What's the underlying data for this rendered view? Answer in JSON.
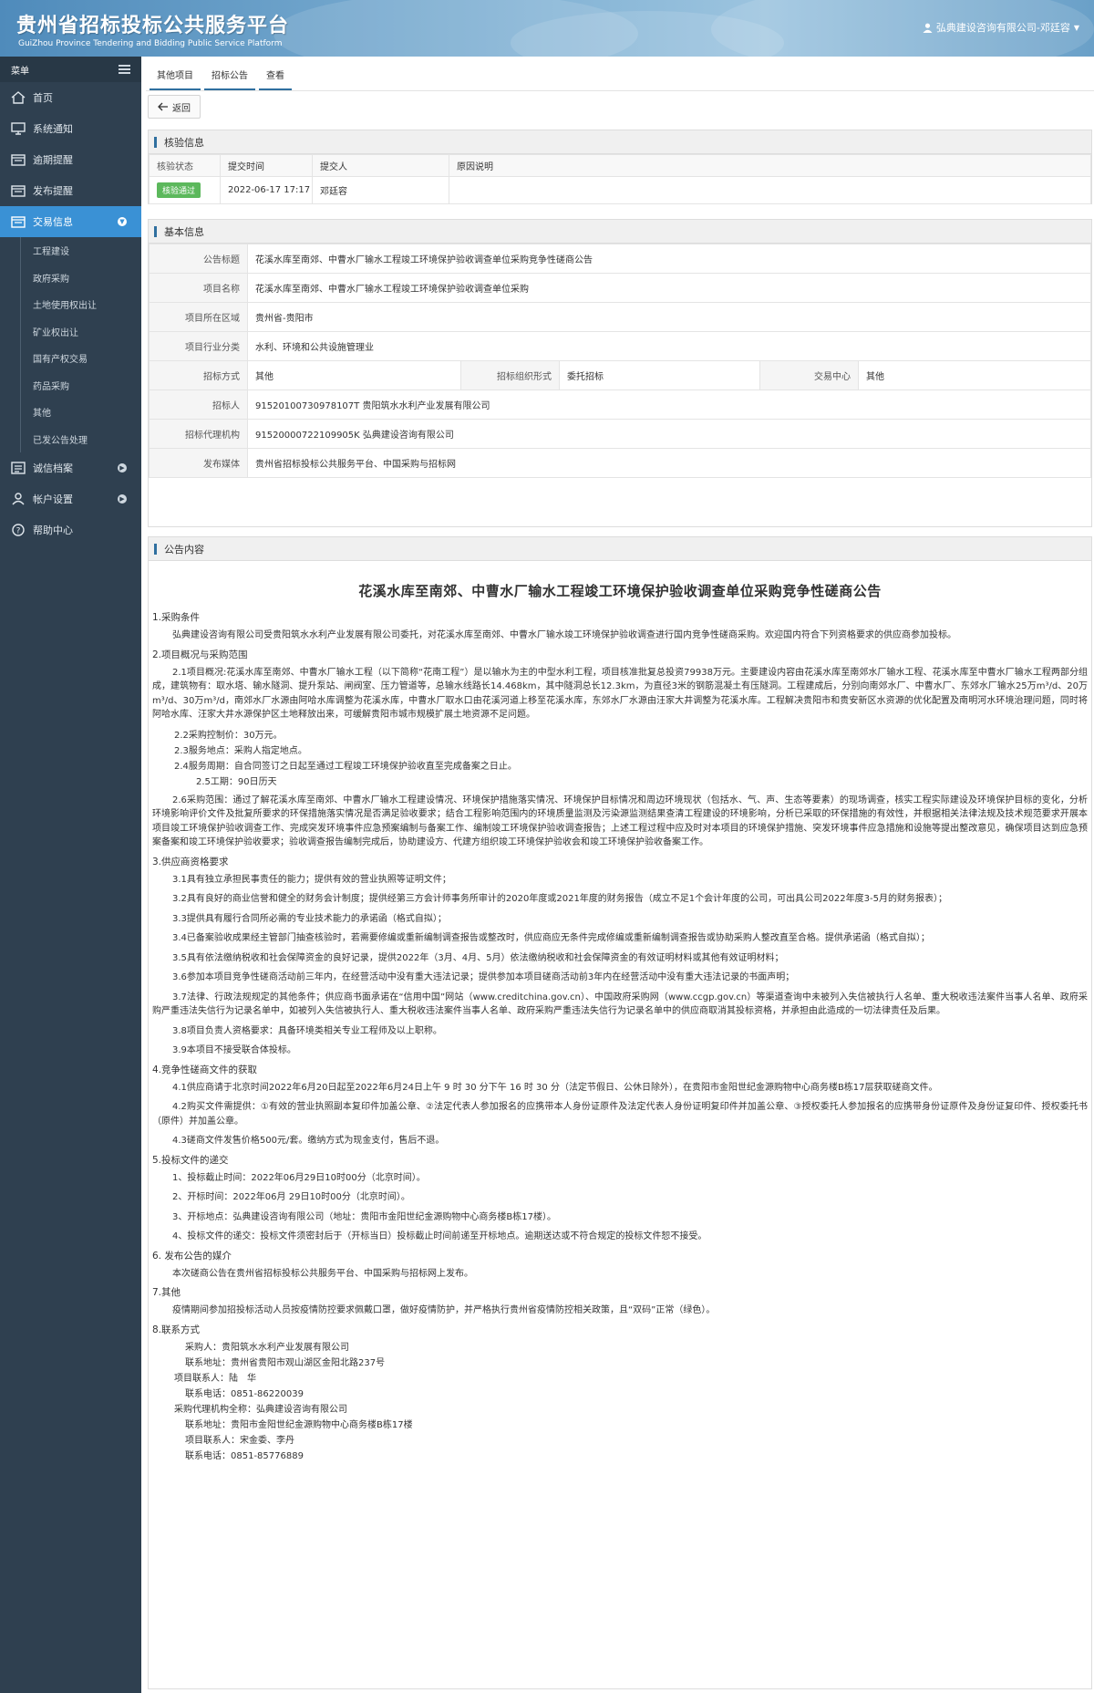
{
  "header": {
    "title": "贵州省招标投标公共服务平台",
    "subtitle": "GuiZhou Province Tendering and Bidding Public Service Platform",
    "user": "弘典建设咨询有限公司-邓廷容"
  },
  "sidebar": {
    "menu_label": "菜单",
    "items": [
      {
        "label": "首页",
        "icon": "home-icon"
      },
      {
        "label": "系统通知",
        "icon": "monitor-icon"
      },
      {
        "label": "逾期提醒",
        "icon": "folder-icon"
      },
      {
        "label": "发布提醒",
        "icon": "folder-icon"
      },
      {
        "label": "交易信息",
        "icon": "folder-icon",
        "active": true
      },
      {
        "label": "诚信档案",
        "icon": "list-icon"
      },
      {
        "label": "帐户设置",
        "icon": "user-icon"
      },
      {
        "label": "帮助中心",
        "icon": "help-icon"
      }
    ],
    "subitems": [
      "工程建设",
      "政府采购",
      "土地使用权出让",
      "矿业权出让",
      "国有产权交易",
      "药品采购",
      "其他",
      "已发公告处理"
    ]
  },
  "breadcrumb": [
    "其他项目",
    "招标公告",
    "查看"
  ],
  "toolbar": {
    "back_label": "返回"
  },
  "verify": {
    "title": "核验信息",
    "headers": [
      "核验状态",
      "提交时间",
      "提交人",
      "原因说明"
    ],
    "status": "核验通过",
    "time": "2022-06-17 17:17",
    "submitter": "邓廷容",
    "reason": ""
  },
  "basic": {
    "title": "基本信息",
    "rows": [
      {
        "label": "公告标题",
        "value": "花溪水库至南郊、中曹水厂输水工程竣工环境保护验收调查单位采购竞争性磋商公告"
      },
      {
        "label": "项目名称",
        "value": "花溪水库至南郊、中曹水厂输水工程竣工环境保护验收调查单位采购"
      },
      {
        "label": "项目所在区域",
        "value": "贵州省-贵阳市"
      },
      {
        "label": "项目行业分类",
        "value": "水利、环境和公共设施管理业"
      }
    ],
    "method_label": "招标方式",
    "method": "其他",
    "org_label": "招标组织形式",
    "org": "委托招标",
    "center_label": "交易中心",
    "center": "其他",
    "rows2": [
      {
        "label": "招标人",
        "value": "91520100730978107T 贵阳筑水水利产业发展有限公司"
      },
      {
        "label": "招标代理机构",
        "value": "91520000722109905K 弘典建设咨询有限公司"
      },
      {
        "label": "发布媒体",
        "value": "贵州省招标投标公共服务平台、中国采购与招标网"
      }
    ]
  },
  "notice": {
    "title": "公告内容",
    "article_title": "花溪水库至南郊、中曹水厂输水工程竣工环境保护验收调查单位采购竞争性磋商公告",
    "s1": "1.采购条件",
    "p1": "弘典建设咨询有限公司受贵阳筑水水利产业发展有限公司委托，对花溪水库至南郊、中曹水厂输水竣工环境保护验收调查进行国内竞争性磋商采购。欢迎国内符合下列资格要求的供应商参加投标。",
    "s2": "2.项目概况与采购范围",
    "p2_1": "2.1项目概况:花溪水库至南郊、中曹水厂输水工程（以下简称“花南工程”）是以输水为主的中型水利工程，项目核准批复总投资79938万元。主要建设内容由花溪水库至南郊水厂输水工程、花溪水库至中曹水厂输水工程两部分组成，建筑物有：取水塔、输水隧洞、提升泵站、闸阀室、压力管道等，总输水线路长14.468km，其中隧洞总长12.3km，为直径3米的钢筋混凝土有压隧洞。工程建成后，分别向南郊水厂、中曹水厂、东郊水厂输水25万m³/d、20万m³/d、30万m³/d，南郊水厂水源由阿哈水库调整为花溪水库，中曹水厂取水口由花溪河道上移至花溪水库，东郊水厂水源由汪家大井调整为花溪水库。工程解决贵阳市和贵安新区水资源的优化配置及南明河水环境治理问题，同时将阿哈水库、汪家大井水源保护区土地释放出来，可缓解贵阳市城市规模扩展土地资源不足问题。",
    "l2_2": "2.2采购控制价：30万元。",
    "l2_3": "2.3服务地点：采购人指定地点。",
    "l2_4": "2.4服务周期：自合同签订之日起至通过工程竣工环境保护验收直至完成备案之日止。",
    "l2_5": "2.5工期：90日历天",
    "p2_6": "2.6采购范围：通过了解花溪水库至南郊、中曹水厂输水工程建设情况、环境保护措施落实情况、环境保护目标情况和周边环境现状（包括水、气、声、生态等要素）的现场调查，核实工程实际建设及环境保护目标的变化，分析环境影响评价文件及批复所要求的环保措施落实情况是否满足验收要求；结合工程影响范围内的环境质量监测及污染源监测结果查清工程建设的环境影响，分析已采取的环保措施的有效性，并根据相关法律法规及技术规范要求开展本项目竣工环境保护验收调查工作、完成突发环境事件应急预案编制与备案工作、编制竣工环境保护验收调查报告；上述工程过程中应及时对本项目的环境保护措施、突发环境事件应急措施和设施等提出整改意见，确保项目达到应急预案备案和竣工环境保护验收要求；验收调查报告编制完成后，协助建设方、代建方组织竣工环境保护验收会和竣工环境保护验收备案工作。",
    "s3": "3.供应商资格要求",
    "p3_1": "3.1具有独立承担民事责任的能力；提供有效的营业执照等证明文件；",
    "p3_2": "3.2具有良好的商业信誉和健全的财务会计制度；提供经第三方会计师事务所审计的2020年度或2021年度的财务报告（成立不足1个会计年度的公司，可出具公司2022年度3-5月的财务报表）；",
    "p3_3": "3.3提供具有履行合同所必需的专业技术能力的承诺函（格式自拟）；",
    "p3_4": "3.4已备案验收成果经主管部门抽查核验时，若需要修编或重新编制调查报告或整改时，供应商应无条件完成修编或重新编制调查报告或协助采购人整改直至合格。提供承诺函（格式自拟）；",
    "p3_5": "3.5具有依法缴纳税收和社会保障资金的良好记录，提供2022年（3月、4月、5月）依法缴纳税收和社会保障资金的有效证明材料或其他有效证明材料；",
    "p3_6": "3.6参加本项目竞争性磋商活动前三年内，在经营活动中没有重大违法记录；提供参加本项目磋商活动前3年内在经营活动中没有重大违法记录的书面声明；",
    "p3_7": "3.7法律、行政法规规定的其他条件；供应商书面承诺在“信用中国”网站（www.creditchina.gov.cn）、中国政府采购网（www.ccgp.gov.cn）等渠道查询中未被列入失信被执行人名单、重大税收违法案件当事人名单、政府采购严重违法失信行为记录名单中，如被列入失信被执行人、重大税收违法案件当事人名单、政府采购严重违法失信行为记录名单中的供应商取消其投标资格，并承担由此造成的一切法律责任及后果。",
    "p3_8": "3.8项目负责人资格要求：具备环境类相关专业工程师及以上职称。",
    "p3_9": "3.9本项目不接受联合体投标。",
    "s4": "4.竞争性磋商文件的获取",
    "p4_1": "4.1供应商请于北京时间2022年6月20日起至2022年6月24日上午 9 时 30 分下午 16 时 30 分（法定节假日、公休日除外），在贵阳市金阳世纪金源购物中心商务楼B栋17层获取磋商文件。",
    "p4_2": "4.2购买文件需提供：①有效的营业执照副本复印件加盖公章、②法定代表人参加报名的应携带本人身份证原件及法定代表人身份证明复印件并加盖公章、③授权委托人参加报名的应携带身份证原件及身份证复印件、授权委托书（原件）并加盖公章。",
    "p4_3": "4.3磋商文件发售价格500元/套。缴纳方式为现金支付，售后不退。",
    "s5": "5.投标文件的递交",
    "p5_1": "1、投标截止时间：2022年06月29日10时00分（北京时间）。",
    "p5_2": "2、开标时间：2022年06月 29日10时00分（北京时间）。",
    "p5_3": "3、开标地点：弘典建设咨询有限公司（地址：贵阳市金阳世纪金源购物中心商务楼B栋17楼）。",
    "p5_4": "4、投标文件的递交：投标文件须密封后于（开标当日）投标截止时间前递至开标地点。逾期送达或不符合规定的投标文件恕不接受。",
    "s6": "6. 发布公告的媒介",
    "p6": "本次磋商公告在贵州省招标投标公共服务平台、中国采购与招标网上发布。",
    "s7": "7.其他",
    "p7": "疫情期间参加招投标活动人员按疫情防控要求佩戴口罩，做好疫情防护，并严格执行贵州省疫情防控相关政策，且“双码”正常（绿色）。",
    "s8": "8.联系方式",
    "c1": "采购人：贵阳筑水水利产业发展有限公司",
    "c2": "联系地址：贵州省贵阳市观山湖区金阳北路237号",
    "c3": "项目联系人：陆　华",
    "c4": "联系电话：0851-86220039",
    "c5": "采购代理机构全称：弘典建设咨询有限公司",
    "c6": "联系地址：贵阳市金阳世纪金源购物中心商务楼B栋17楼",
    "c7": "项目联系人：宋金委、李丹",
    "c8": "联系电话：0851-85776889"
  }
}
